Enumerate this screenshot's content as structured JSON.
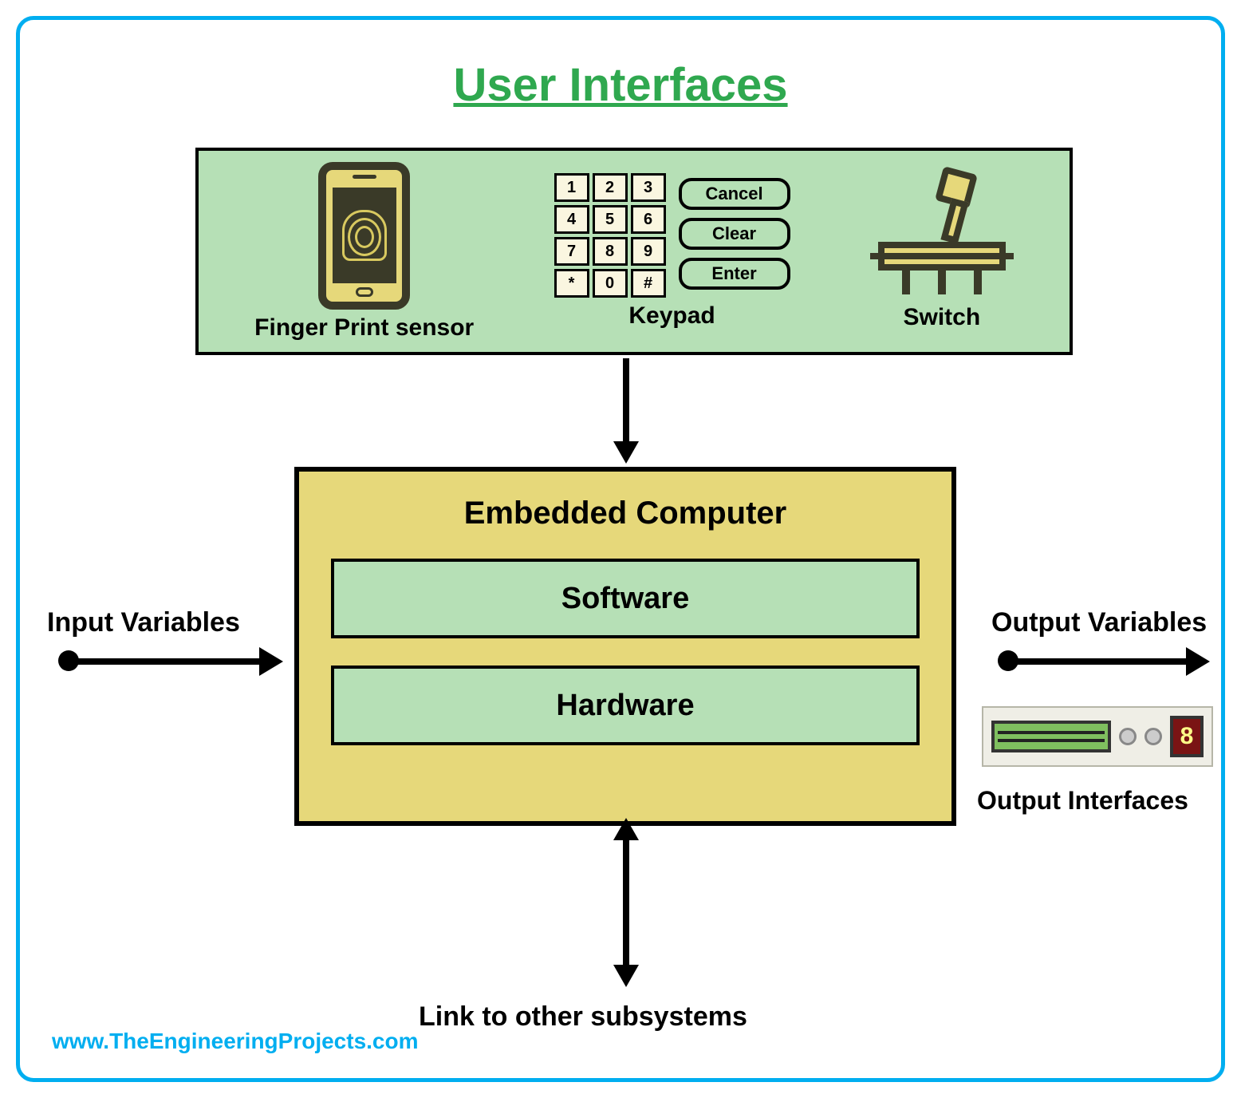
{
  "title": "User Interfaces",
  "ui_panel": {
    "items": [
      {
        "label": "Finger Print sensor"
      },
      {
        "label": "Keypad"
      },
      {
        "label": "Switch"
      }
    ],
    "keypad": {
      "keys": [
        "1",
        "2",
        "3",
        "4",
        "5",
        "6",
        "7",
        "8",
        "9",
        "*",
        "0",
        "#"
      ],
      "actions": [
        "Cancel",
        "Clear",
        "Enter"
      ]
    }
  },
  "embedded": {
    "title": "Embedded Computer",
    "layers": [
      "Software",
      "Hardware"
    ]
  },
  "input_label": "Input Variables",
  "output_label": "Output Variables",
  "output_interfaces_label": "Output Interfaces",
  "link_label": "Link to other subsystems",
  "credit": "www.TheEngineeringProjects.com",
  "output_device_seg": "8"
}
